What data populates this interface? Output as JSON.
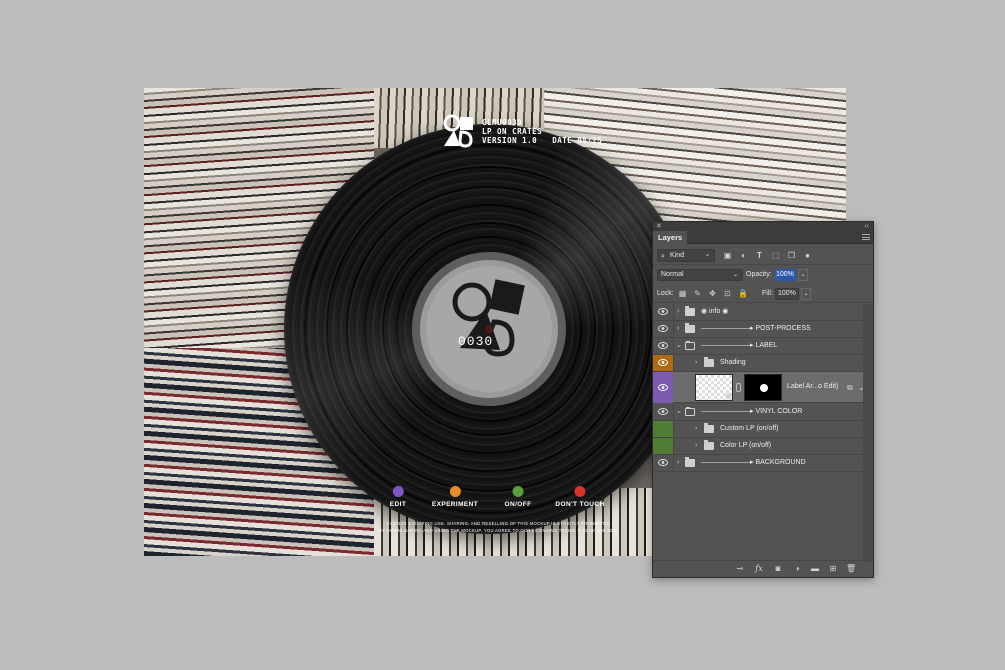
{
  "mockup": {
    "catalog": "GLMU0030",
    "product": "LP ON CRATES",
    "version": "VERSION 1.0",
    "date": "DATE 08/25",
    "label_number": "0030",
    "legend": [
      {
        "label": "EDIT",
        "color": "#7b56c4"
      },
      {
        "label": "EXPERIMENT",
        "color": "#e98b2a"
      },
      {
        "label": "ON/OFF",
        "color": "#57a03a"
      },
      {
        "label": "DON'T TOUCH",
        "color": "#d8322b"
      }
    ],
    "license_line1": "LICENSE VIOLATING USE, SHARING, AND RESELLING OF THIS MOCKUP IS STRICTLY PROHIBITED.",
    "license_line2": "BY DOWNLOADING AND USING THE MOCKUP, YOU AGREE TO OUR LICENSING TERMS. © GLUE LAB 2025."
  },
  "panel": {
    "tab": "Layers",
    "filter_kind": "Kind",
    "blend_mode": "Normal",
    "opacity_label": "Opacity:",
    "opacity_value": "100%",
    "lock_label": "Lock:",
    "fill_label": "Fill:",
    "fill_value": "100%",
    "layers": [
      {
        "name": "◉ info ◉",
        "tag": "none"
      },
      {
        "name": "———————▸ POST-PROCESS",
        "tag": "none"
      },
      {
        "name": "———————▸ LABEL",
        "tag": "none"
      },
      {
        "name": "Shading",
        "tag": "orange"
      },
      {
        "name": "Label Ar...o Edit)",
        "tag": "purple"
      },
      {
        "name": "———————▸ VINYL COLOR",
        "tag": "none"
      },
      {
        "name": "Custom LP (on/off)",
        "tag": "green"
      },
      {
        "name": "Color LP (on/off)",
        "tag": "green"
      },
      {
        "name": "———————▸ BACKGROUND",
        "tag": "none"
      }
    ],
    "tag_colors": {
      "orange": "#b06a12",
      "purple": "#7d5bb0",
      "green": "#4f7e34"
    }
  }
}
